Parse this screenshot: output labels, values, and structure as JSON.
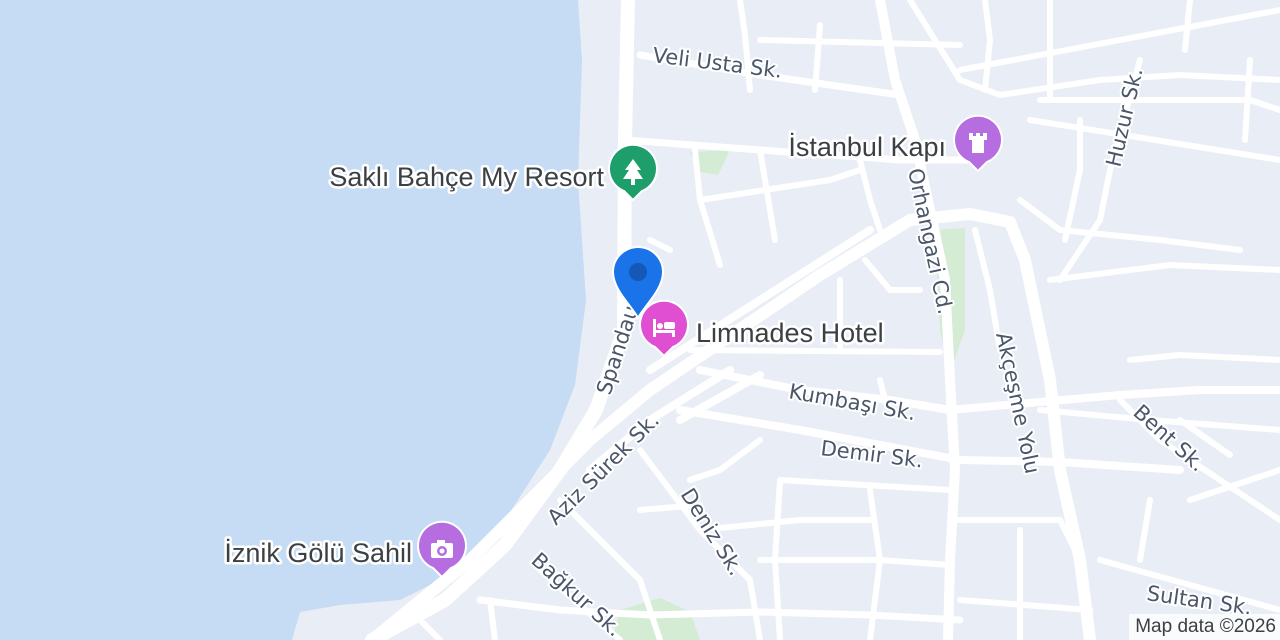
{
  "map": {
    "colors": {
      "water": "#c6dbf4",
      "land": "#e9edf6",
      "road": "#ffffff",
      "park": "#d4ecd3",
      "park_pin": "#1e9e6b",
      "attraction_pin": "#b56de0",
      "hotel_pin": "#e04fd2",
      "location_pin": "#1a73e8"
    },
    "streets": {
      "veli_usta": "Veli Usta Sk.",
      "huzur": "Huzur Sk.",
      "orhangazi": "Orhangazi Cd.",
      "spandau": "Spandau",
      "akcesme": "Akçeşme Yolu",
      "kumbasi": "Kumbaşı Sk.",
      "demir": "Demir Sk.",
      "bent": "Bent Sk.",
      "aziz_surek": "Aziz Sürek Sk.",
      "deniz": "Deniz Sk.",
      "bagkur": "Bağkur Sk.",
      "sultan": "Sultan Sk."
    },
    "pois": {
      "istanbul_kapi": {
        "label": "İstanbul Kapı",
        "icon": "castle-icon"
      },
      "sakli_bahce": {
        "label": "Saklı Bahçe My Resort",
        "icon": "tree-icon"
      },
      "limnades": {
        "label": "Limnades Hotel",
        "icon": "bed-icon"
      },
      "iznik_golu": {
        "label": "İznik Gölü Sahil",
        "icon": "camera-icon"
      }
    },
    "location_marker": {
      "icon": "location-pin-icon"
    }
  },
  "attribution": "Map data ©2026"
}
